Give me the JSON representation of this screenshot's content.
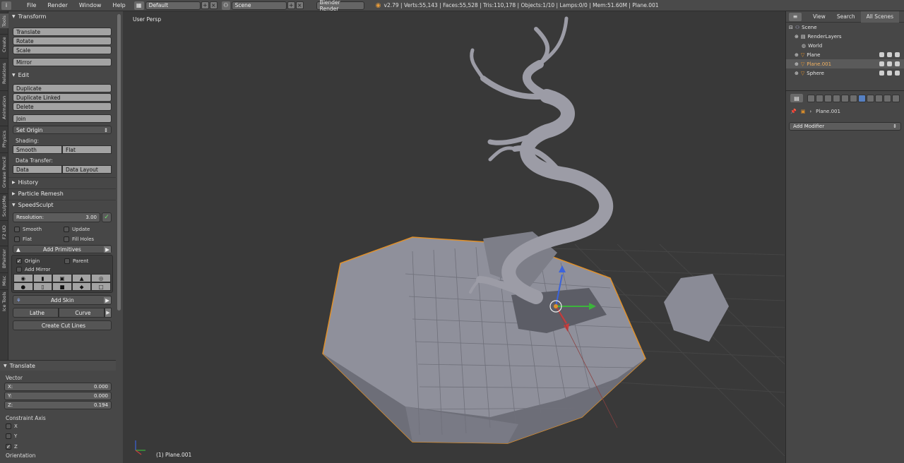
{
  "topbar": {
    "menus": [
      "File",
      "Render",
      "Window",
      "Help"
    ],
    "layout": "Default",
    "scene": "Scene",
    "engine": "Blender Render",
    "stats": "v2.79 | Verts:55,143 | Faces:55,528 | Tris:110,178 | Objects:1/10 | Lamps:0/0 | Mem:51.60M | Plane.001"
  },
  "tabs": [
    "Tools",
    "Create",
    "Relations",
    "Animation",
    "Physics",
    "Grease Pencil",
    "SculptMe",
    "F2 UD",
    "BPainter",
    "Misc",
    "Ice Tools"
  ],
  "toolshelf": {
    "transform": {
      "title": "Transform",
      "translate": "Translate",
      "rotate": "Rotate",
      "scale": "Scale",
      "mirror": "Mirror"
    },
    "edit": {
      "title": "Edit",
      "duplicate": "Duplicate",
      "duplicate_linked": "Duplicate Linked",
      "delete": "Delete",
      "join": "Join",
      "set_origin": "Set Origin",
      "shading_label": "Shading:",
      "smooth": "Smooth",
      "flat": "Flat",
      "data_transfer_label": "Data Transfer:",
      "data": "Data",
      "data_layout": "Data Layout"
    },
    "history": "History",
    "particle_remesh": "Particle Remesh",
    "speedsculpt": {
      "title": "SpeedSculpt",
      "resolution_label": "Resolution:",
      "resolution_value": "3.00",
      "smooth": "Smooth",
      "update": "Update",
      "flat": "Flat",
      "fill_holes": "Fill Holes",
      "add_primitives": "Add Primitives",
      "origin": "Origin",
      "parent": "Parent",
      "add_mirror": "Add Mirror",
      "add_skin": "Add Skin",
      "lathe": "Lathe",
      "curve": "Curve",
      "create_cut": "Create Cut Lines"
    }
  },
  "operator": {
    "title": "Translate",
    "vector_label": "Vector",
    "x_label": "X:",
    "x": "0.000",
    "y_label": "Y:",
    "y": "0.000",
    "z_label": "Z:",
    "z": "0.194",
    "constraint_label": "Constraint Axis",
    "cx": "X",
    "cy": "Y",
    "cz": "Z",
    "orientation_label": "Orientation"
  },
  "viewport": {
    "title": "User Persp",
    "object_label": "(1) Plane.001"
  },
  "outliner": {
    "tabs": [
      "View",
      "Search",
      "All Scenes"
    ],
    "rows": [
      {
        "name": "Scene"
      },
      {
        "name": "RenderLayers"
      },
      {
        "name": "World"
      },
      {
        "name": "Plane"
      },
      {
        "name": "Plane.001"
      },
      {
        "name": "Sphere"
      }
    ]
  },
  "properties": {
    "object_name": "Plane.001",
    "add_modifier": "Add Modifier"
  },
  "colors": {
    "selection_outline": "#e0902a",
    "mesh": "#9b9ca6",
    "grid_line": "#4a4a4a",
    "x_axis": "#c83c3c",
    "y_axis": "#3cb43c",
    "z_axis": "#3c64dc"
  }
}
